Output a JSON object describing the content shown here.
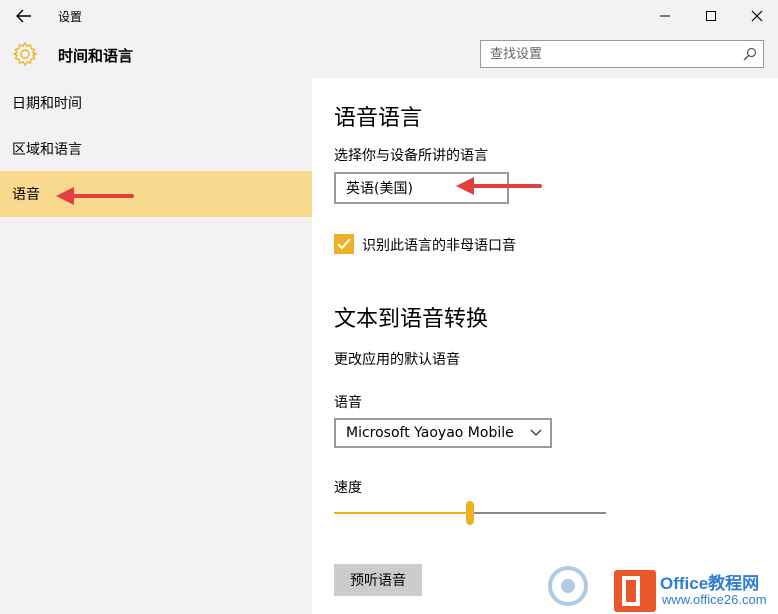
{
  "window": {
    "title": "设置"
  },
  "header": {
    "title": "时间和语言",
    "search_placeholder": "查找设置"
  },
  "sidebar": {
    "items": [
      {
        "label": "日期和时间",
        "selected": false
      },
      {
        "label": "区域和语言",
        "selected": false
      },
      {
        "label": "语音",
        "selected": true
      }
    ]
  },
  "main": {
    "speech_language": {
      "heading": "语音语言",
      "prompt": "选择你与设备所讲的语言",
      "selected_value": "英语(美国)",
      "checkbox_label": "识别此语言的非母语口音",
      "checkbox_checked": true
    },
    "tts": {
      "heading": "文本到语音转换",
      "subtitle": "更改应用的默认语音",
      "voice_label": "语音",
      "voice_value": "Microsoft Yaoyao Mobile",
      "speed_label": "速度",
      "speed_value": 0.5,
      "preview_label": "预听语音"
    }
  },
  "watermark": {
    "brand": "Office教程网",
    "url": "www.office26.com"
  },
  "colors": {
    "accent": "#f0b023",
    "selected_bg": "#f8d98e",
    "arrow": "#e04040"
  }
}
